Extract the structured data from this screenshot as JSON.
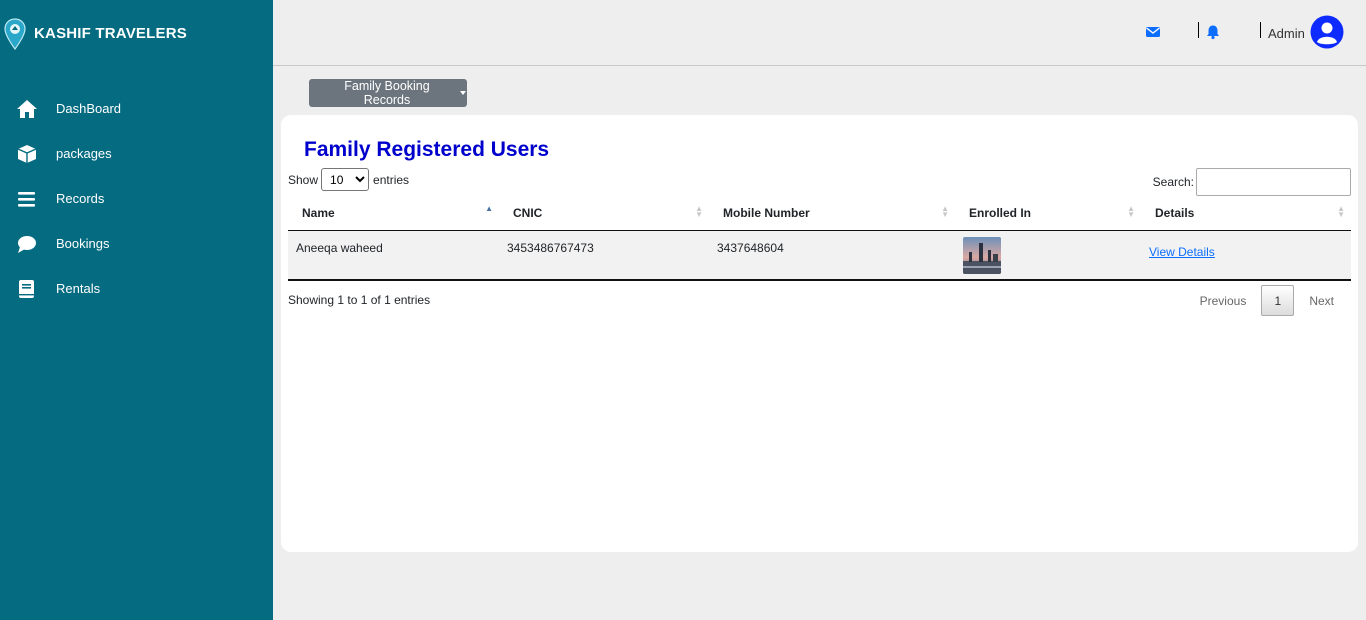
{
  "brand": {
    "name": "KASHIF TRAVELERS",
    "logo_icon": "map-pin-icon"
  },
  "sidebar": {
    "items": [
      {
        "label": "DashBoard",
        "icon": "home-icon"
      },
      {
        "label": "packages",
        "icon": "box-icon"
      },
      {
        "label": "Records",
        "icon": "list-icon"
      },
      {
        "label": "Bookings",
        "icon": "chat-bubble-icon"
      },
      {
        "label": "Rentals",
        "icon": "book-icon"
      }
    ]
  },
  "topbar": {
    "mail_icon": "envelope-icon",
    "bell_icon": "bell-icon",
    "user_name": "Admin",
    "avatar_icon": "user-circle-icon",
    "accent": "#0d6efd"
  },
  "dropdown": {
    "label": "Family Booking Records"
  },
  "card": {
    "title": "Family Registered Users",
    "show_label": "Show",
    "entries_label": "entries",
    "page_length": "10",
    "page_length_options": [
      "10"
    ],
    "search_label": "Search:",
    "search_value": "",
    "columns": [
      "Name",
      "CNIC",
      "Mobile Number",
      "Enrolled In",
      "Details"
    ],
    "rows": [
      {
        "name": "Aneeqa waheed",
        "cnic": "3453486767473",
        "mobile": "3437648604",
        "enrolled_thumb": "city-photo",
        "details_link": "View Details"
      }
    ],
    "info": "Showing 1 to 1 of 1 entries",
    "pagination": {
      "previous": "Previous",
      "current": "1",
      "next": "Next"
    }
  },
  "colors": {
    "sidebar_bg": "#046b80",
    "title": "#0000cc",
    "button_bg": "#6c757d"
  }
}
